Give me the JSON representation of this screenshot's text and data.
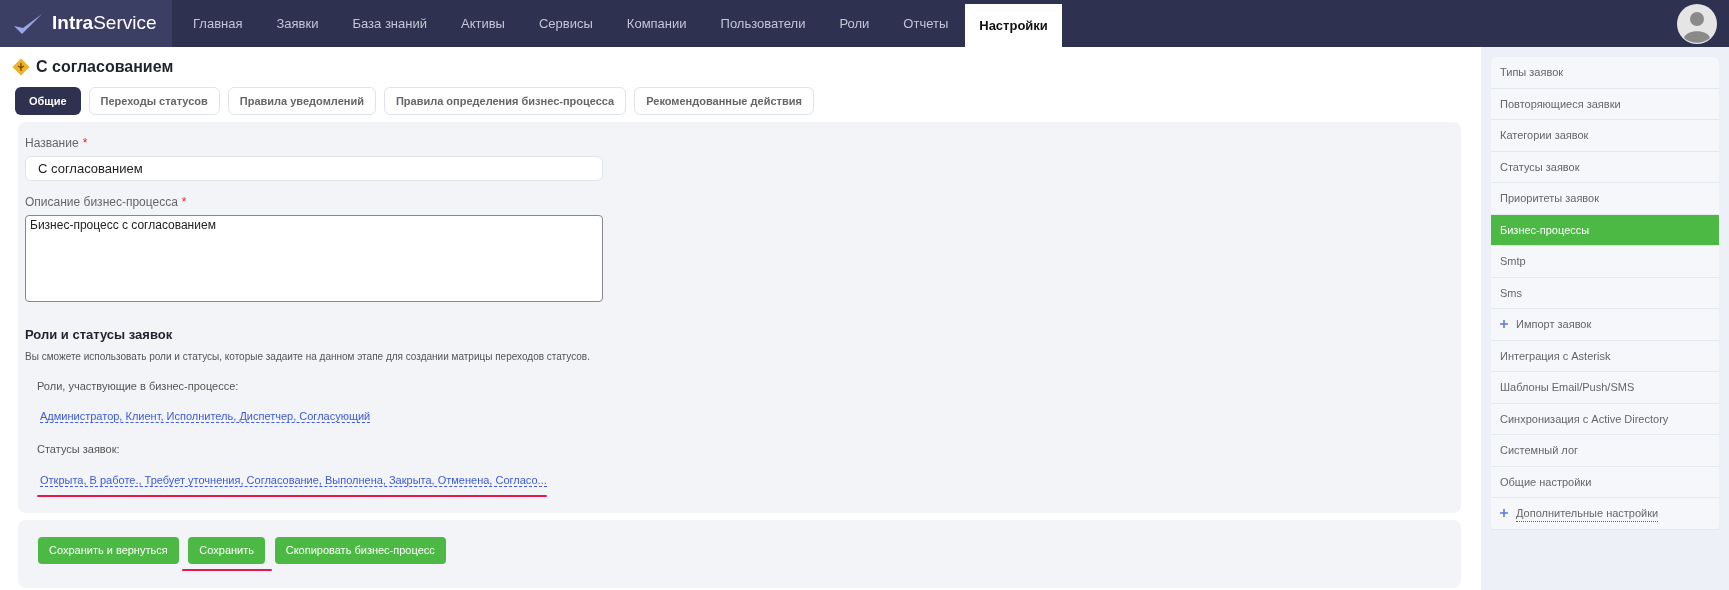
{
  "header": {
    "logo": {
      "bold": "Intra",
      "rest": "Service"
    },
    "nav": [
      {
        "label": "Главная",
        "selected": false
      },
      {
        "label": "Заявки",
        "selected": false
      },
      {
        "label": "База знаний",
        "selected": false
      },
      {
        "label": "Активы",
        "selected": false
      },
      {
        "label": "Сервисы",
        "selected": false
      },
      {
        "label": "Компании",
        "selected": false
      },
      {
        "label": "Пользователи",
        "selected": false
      },
      {
        "label": "Роли",
        "selected": false
      },
      {
        "label": "Отчеты",
        "selected": false
      },
      {
        "label": "Настройки",
        "selected": true
      }
    ]
  },
  "page": {
    "title": "С согласованием",
    "tabs": [
      {
        "label": "Общие",
        "selected": true
      },
      {
        "label": "Переходы статусов",
        "selected": false
      },
      {
        "label": "Правила уведомлений",
        "selected": false
      },
      {
        "label": "Правила определения бизнес-процесса",
        "selected": false
      },
      {
        "label": "Рекомендованные действия",
        "selected": false
      }
    ],
    "form": {
      "name": {
        "label": "Название",
        "required_mark": "*",
        "value": "С согласованием"
      },
      "description": {
        "label": "Описание бизнес-процесса",
        "required_mark": "*",
        "value": "Бизнес-процесс с согласованием"
      },
      "section": {
        "heading": "Роли и статусы заявок",
        "hint": "Вы сможете использовать роли и статусы, которые задаите на данном этапе для создании матрицы переходов статусов.",
        "fields": [
          {
            "label": "Роли, участвующие в бизнес-процессе:",
            "value": "Администратор, Клиент, Исполнитель, Диспетчер, Согласующий",
            "underlined": false
          },
          {
            "label": "Статусы заявок:",
            "value": "Открыта, В работе., Требует уточнения, Согласование, Выполнена, Закрыта, Отменена, Согласо...",
            "underlined": true
          }
        ]
      }
    },
    "buttons": [
      {
        "label": "Сохранить и вернуться",
        "underlined": false
      },
      {
        "label": "Сохранить",
        "underlined": true
      },
      {
        "label": "Скопировать бизнес-процесс",
        "underlined": false
      }
    ]
  },
  "sidebar": {
    "items": [
      {
        "label": "Типы заявок",
        "selected": false,
        "kind": "plain"
      },
      {
        "label": "Повторяющиеся заявки",
        "selected": false,
        "kind": "plain"
      },
      {
        "label": "Категории заявок",
        "selected": false,
        "kind": "plain"
      },
      {
        "label": "Статусы заявок",
        "selected": false,
        "kind": "plain"
      },
      {
        "label": "Приоритеты заявок",
        "selected": false,
        "kind": "plain"
      },
      {
        "label": "Бизнес-процессы",
        "selected": true,
        "kind": "plain"
      },
      {
        "label": "Smtp",
        "selected": false,
        "kind": "plain"
      },
      {
        "label": "Sms",
        "selected": false,
        "kind": "plain"
      },
      {
        "label": "Импорт заявок",
        "selected": false,
        "kind": "plus"
      },
      {
        "label": "Интеграция с Asterisk",
        "selected": false,
        "kind": "plain"
      },
      {
        "label": "Шаблоны Email/Push/SMS",
        "selected": false,
        "kind": "plain"
      },
      {
        "label": "Синхронизация с Active Directory",
        "selected": false,
        "kind": "plain"
      },
      {
        "label": "Системный лог",
        "selected": false,
        "kind": "plain"
      },
      {
        "label": "Общие настройки",
        "selected": false,
        "kind": "plain"
      },
      {
        "label": "Дополнительные настройки",
        "selected": false,
        "kind": "plus-link"
      }
    ]
  }
}
